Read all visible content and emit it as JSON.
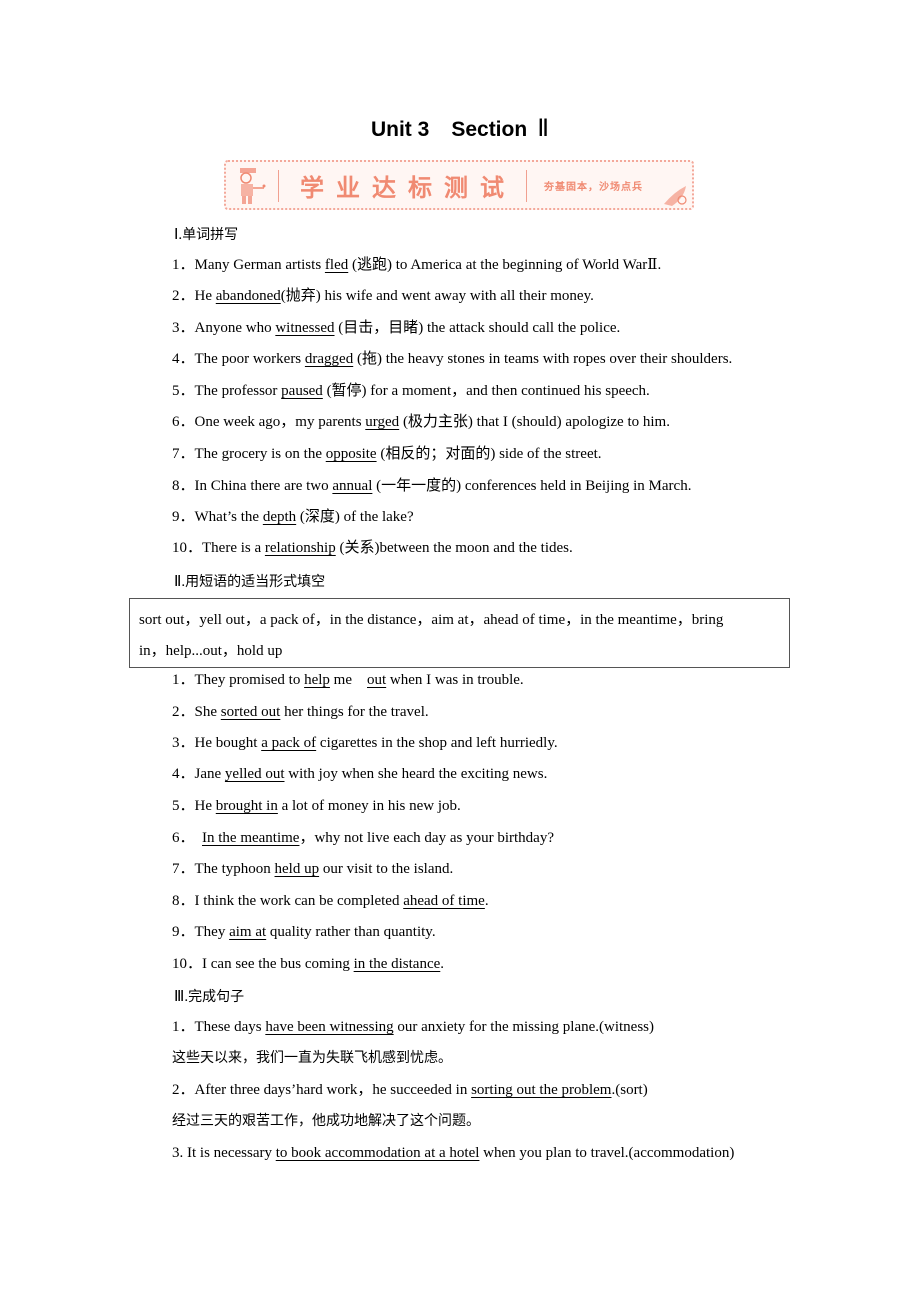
{
  "title": {
    "unit": "Unit 3",
    "section": "Section",
    "roman": "Ⅱ"
  },
  "banner": {
    "main": "学业达标测试",
    "sub": "夯基固本，沙场点兵",
    "color": "#f08a72"
  },
  "section1": {
    "heading_roman": "Ⅰ.",
    "heading": "单词拼写",
    "items": [
      {
        "num": "1．",
        "pre": "Many German artists ",
        "ans": "fled",
        "post": " (逃跑) to America at the beginning of World WarⅡ."
      },
      {
        "num": "2．",
        "pre": "He ",
        "ans": "abandoned",
        "post": "(抛弃) his wife and went away with all their money."
      },
      {
        "num": "3．",
        "pre": "Anyone who ",
        "ans": "witnessed",
        "post": " (目击，目睹) the attack should call the police."
      },
      {
        "num": "4．",
        "pre": "The poor workers ",
        "ans": "dragged",
        "post": " (拖) the heavy stones in teams with ropes over their shoulders."
      },
      {
        "num": "5．",
        "pre": "The professor ",
        "ans": "paused",
        "post": " (暂停) for a moment，and then continued his speech."
      },
      {
        "num": "6．",
        "pre": "One week ago，my parents ",
        "ans": "urged",
        "post": " (极力主张) that I (should) apologize to him."
      },
      {
        "num": "7．",
        "pre": "The grocery is on the ",
        "ans": "opposite",
        "post": " (相反的；对面的) side of the street."
      },
      {
        "num": "8．",
        "pre": "In China there are two ",
        "ans": "annual",
        "post": " (一年一度的) conferences held in Beijing in March."
      },
      {
        "num": "9．",
        "pre": "What’s the ",
        "ans": "depth",
        "post": " (深度) of the lake?"
      },
      {
        "num": "10．",
        "pre": "There is a ",
        "ans": "relationship",
        "post": " (关系)between the moon and the tides."
      }
    ]
  },
  "section2": {
    "heading_roman": "Ⅱ.",
    "heading": "用短语的适当形式填空",
    "box_line1": "sort out，yell out，a pack of，in the distance，aim at，ahead of time，in the meantime，bring",
    "box_line2": "in，help...out，hold up",
    "items": [
      {
        "num": "1．",
        "pre": "They promised to ",
        "ans": "help",
        "mid": " me　",
        "ans2": "out",
        "post": " when I was in trouble."
      },
      {
        "num": "2．",
        "pre": "She ",
        "ans": "sorted out",
        "post": " her things for the travel."
      },
      {
        "num": "3．",
        "pre": "He bought ",
        "ans": "a pack of",
        "post": " cigarettes in the shop and left hurriedly."
      },
      {
        "num": "4．",
        "pre": "Jane ",
        "ans": "yelled out",
        "post": " with joy when she heard the exciting news."
      },
      {
        "num": "5．",
        "pre": "He ",
        "ans": "brought in",
        "post": " a lot of money in his new job."
      },
      {
        "num": "6．",
        "pre": " ",
        "ans": "In the meantime",
        "post": "，why not live each day as your birthday?"
      },
      {
        "num": "7．",
        "pre": "The typhoon ",
        "ans": "held up",
        "post": " our visit to the island."
      },
      {
        "num": "8．",
        "pre": "I think the work can be completed ",
        "ans": "ahead of time",
        "post": "."
      },
      {
        "num": "9．",
        "pre": "They ",
        "ans": "aim at",
        "post": " quality rather than quantity."
      },
      {
        "num": "10．",
        "pre": "I can see the bus coming ",
        "ans": "in the distance",
        "post": "."
      }
    ]
  },
  "section3": {
    "heading_roman": "Ⅲ.",
    "heading": "完成句子",
    "items": [
      {
        "num": "1．",
        "pre": "These days ",
        "ans": "have been witnessing",
        "post": " our anxiety for the missing plane.(witness)",
        "cn": "这些天以来，我们一直为失联飞机感到忧虑。"
      },
      {
        "num": "2．",
        "pre": "After three days’hard work，he succeeded in ",
        "ans": "sorting out the problem",
        "post": ".(sort)",
        "cn": "经过三天的艰苦工作，他成功地解决了这个问题。"
      },
      {
        "num": "3.",
        "pre": " It is necessary ",
        "ans": "to book accommodation at a hotel",
        "post": " when you plan to travel.(accommodation)"
      }
    ]
  }
}
